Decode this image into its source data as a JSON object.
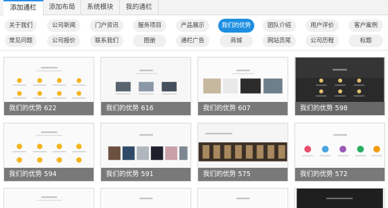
{
  "tabs": [
    {
      "label": "添加通栏",
      "active": true
    },
    {
      "label": "添加布局",
      "active": false
    },
    {
      "label": "系统模块",
      "active": false
    },
    {
      "label": "我的通栏",
      "active": false
    }
  ],
  "categories_row1": [
    {
      "label": "关于我们",
      "active": false
    },
    {
      "label": "公司新闻",
      "active": false
    },
    {
      "label": "门户资讯",
      "active": false
    },
    {
      "label": "服务项目",
      "active": false
    },
    {
      "label": "产品展示",
      "active": false
    },
    {
      "label": "我们的优势",
      "active": true
    },
    {
      "label": "团队介绍",
      "active": false
    },
    {
      "label": "用户评价",
      "active": false
    },
    {
      "label": "客户案例",
      "active": false
    }
  ],
  "categories_row2": [
    {
      "label": "常见问题",
      "active": false
    },
    {
      "label": "公司报价",
      "active": false
    },
    {
      "label": "联系我们",
      "active": false
    },
    {
      "label": "图册",
      "active": false
    },
    {
      "label": "通栏广告",
      "active": false
    },
    {
      "label": "商城",
      "active": false
    },
    {
      "label": "网站页尾",
      "active": false
    },
    {
      "label": "公司历程",
      "active": false
    },
    {
      "label": "标题",
      "active": false
    }
  ],
  "templates": [
    {
      "caption": "我们的优势 622",
      "style": "yellow-icons-light"
    },
    {
      "caption": "我们的优势 616",
      "style": "photos-light"
    },
    {
      "caption": "我们的优势 607",
      "style": "photos-mixed"
    },
    {
      "caption": "我们的优势 598",
      "style": "dark-icons"
    },
    {
      "caption": "我们的优势 594",
      "style": "yellow-circles"
    },
    {
      "caption": "我们的优势 591",
      "style": "photo-strip"
    },
    {
      "caption": "我们的优势 575",
      "style": "dark-band"
    },
    {
      "caption": "我们的优势 572",
      "style": "colored-circles"
    },
    {
      "caption": "",
      "style": "partial-light"
    },
    {
      "caption": "",
      "style": "partial-light"
    },
    {
      "caption": "",
      "style": "partial-light"
    },
    {
      "caption": "",
      "style": "partial-dark"
    }
  ],
  "colors": {
    "accent": "#1d8fe1",
    "caption_bg": "#6e6e6e",
    "icon_yellow": "#f3b51b"
  }
}
